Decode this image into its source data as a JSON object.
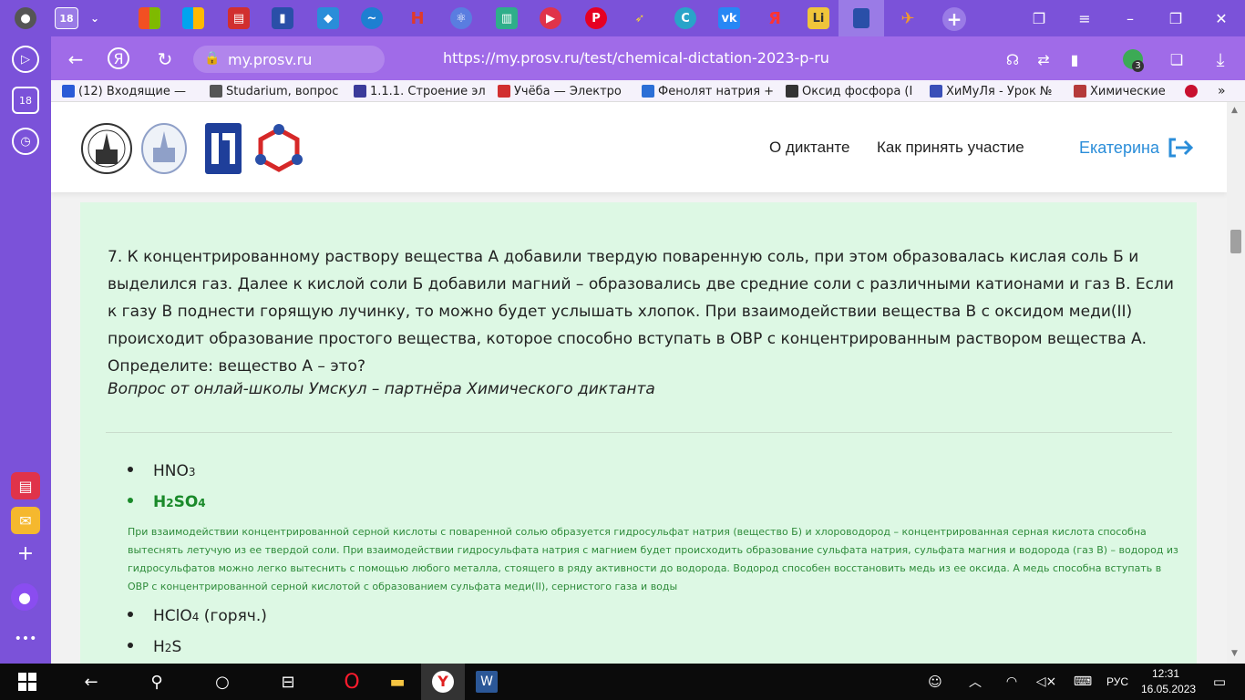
{
  "browser": {
    "tab_count_badge": "18",
    "domain": "my.prosv.ru",
    "url": "https://my.prosv.ru/test/chemical-dictation-2023-p-ru",
    "downloads_badge": "3",
    "bookmarks": [
      {
        "label": "(12) Входящие — ",
        "color": "#2a5bd7"
      },
      {
        "label": "Studarium, вопрос",
        "color": "#555555"
      },
      {
        "label": "1.1.1. Строение эл",
        "color": "#3b3b9a"
      },
      {
        "label": "Учёба — Электро",
        "color": "#d12f2f"
      },
      {
        "label": "Фенолят натрия +",
        "color": "#2b6fd6"
      },
      {
        "label": "Оксид фосфора (I",
        "color": "#333333"
      },
      {
        "label": "ХиМуЛя - Урок №",
        "color": "#3a4fb8"
      },
      {
        "label": "Химические",
        "color": "#b53a3a"
      }
    ],
    "sidebar_badge": "18"
  },
  "site": {
    "nav": {
      "about": "О диктанте",
      "how_to": "Как принять участие",
      "user": "Екатерина"
    }
  },
  "question": {
    "text": "7. К концентрированному раствору вещества А добавили твердую поваренную соль, при этом образовалась кислая соль Б и выделился газ. Далее к кислой соли Б добавили магний – образовались две средние соли с различными катионами и газ В. Если к газу В поднести горящую лучинку, то можно будет услышать хлопок. При взаимодействии вещества В с оксидом меди(II) происходит образование простого вещества, которое способно вступать в ОВР с концентрированным раствором вещества А. Определите: вещество А – это?",
    "partner": "Вопрос от онлай-школы Умскул – партнёра Химического диктанта",
    "options": [
      {
        "base": "HNO",
        "sub": "3",
        "tail": "",
        "correct": false
      },
      {
        "base": "H",
        "sub": "2",
        "mid": "SO",
        "sub2": "4",
        "tail": "",
        "correct": true
      },
      {
        "base": "HClO",
        "sub": "4",
        "tail": " (горяч.)",
        "correct": false
      },
      {
        "base": "H",
        "sub": "2",
        "tail": "S",
        "correct": false
      }
    ],
    "explanation": "При взаимодействии концентрированной серной кислоты с поваренной солью образуется гидросульфат натрия (вещество Б) и хлороводород – концентрированная серная кислота способна вытеснять летучую из ее твердой соли. При взаимодействии гидросульфата натрия с магнием будет происходить образование сульфата натрия, сульфата магния и водорода (газ В) – водород из гидросульфатов можно легко вытеснить с помощью любого металла, стоящего в ряду активности до водорода. Водород способен восстановить медь из ее оксида. А медь способна вступать в ОВР с концентрированной серной кислотой с образованием сульфата меди(II), сернистого газа и воды"
  },
  "taskbar": {
    "lang": "РУС",
    "time": "12:31",
    "date": "16.05.2023"
  },
  "colors": {
    "accent": "#7b52d9",
    "card_bg": "#ddf8e4",
    "correct": "#1a8a2a",
    "link": "#2a8dd9"
  }
}
